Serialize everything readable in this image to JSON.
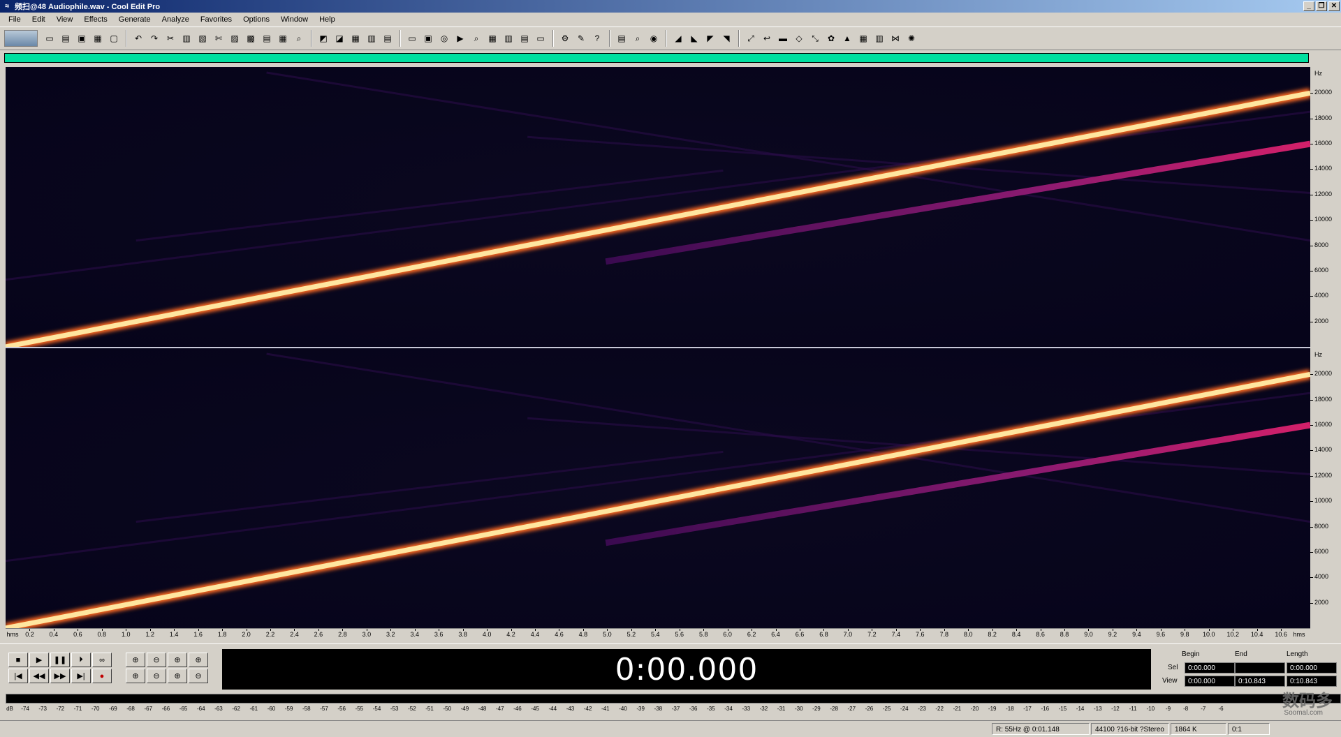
{
  "window": {
    "title": "频扫@48 Audiophile.wav - Cool Edit Pro",
    "app_icon": "cool-edit-icon",
    "controls": [
      "_",
      "❐",
      "✕"
    ]
  },
  "menu": [
    "File",
    "Edit",
    "View",
    "Effects",
    "Generate",
    "Analyze",
    "Favorites",
    "Options",
    "Window",
    "Help"
  ],
  "colors": {
    "overview": "#00e0a0",
    "spectral_background": "#07051a",
    "sweep_main": "#ffe6a0",
    "sweep_harmonic": "#d4206a",
    "channel_separator": "#c8c8d8"
  },
  "spectral": {
    "freq_unit": "Hz",
    "freq_labels": [
      "20000",
      "18000",
      "16000",
      "14000",
      "12000",
      "10000",
      "8000",
      "6000",
      "4000",
      "2000"
    ],
    "time_unit": "hms",
    "time_labels": [
      "0.2",
      "0.4",
      "0.6",
      "0.8",
      "1.0",
      "1.2",
      "1.4",
      "1.6",
      "1.8",
      "2.0",
      "2.2",
      "2.4",
      "2.6",
      "2.8",
      "3.0",
      "3.2",
      "3.4",
      "3.6",
      "3.8",
      "4.0",
      "4.2",
      "4.4",
      "4.6",
      "4.8",
      "5.0",
      "5.2",
      "5.4",
      "5.6",
      "5.8",
      "6.0",
      "6.2",
      "6.4",
      "6.6",
      "6.8",
      "7.0",
      "7.2",
      "7.4",
      "7.6",
      "7.8",
      "8.0",
      "8.2",
      "8.4",
      "8.6",
      "8.8",
      "9.0",
      "9.2",
      "9.4",
      "9.6",
      "9.8",
      "10.0",
      "10.2",
      "10.4",
      "10.6"
    ],
    "channels": [
      {
        "name": "left",
        "sweep_end_hz": 20000,
        "harmonic_end_hz": 16000
      },
      {
        "name": "right",
        "sweep_end_hz": 20000,
        "harmonic_end_hz": 16000
      }
    ],
    "freq_max_hz": 22050,
    "duration_s": 10.843
  },
  "transport": {
    "buttons_row1": [
      "■",
      "▶",
      "❚❚",
      "⏵",
      "∞"
    ],
    "buttons_row2": [
      "|◀",
      "◀◀",
      "▶▶",
      "▶|",
      "●"
    ],
    "zoom_row1": [
      "⊕",
      "⊖",
      "⊕",
      "⊕"
    ],
    "zoom_row2": [
      "⊕",
      "⊖",
      "⊕",
      "⊖"
    ]
  },
  "time_display": "0:00.000",
  "selection": {
    "headers": {
      "begin": "Begin",
      "end": "End",
      "length": "Length"
    },
    "sel_label": "Sel",
    "view_label": "View",
    "sel": {
      "begin": "0:00.000",
      "end": "",
      "length": "0:00.000"
    },
    "view": {
      "begin": "0:00.000",
      "end": "0:10.843",
      "length": "0:10.843"
    }
  },
  "meter": {
    "unit": "dB",
    "labels": [
      "-74",
      "-73",
      "-72",
      "-71",
      "-70",
      "-69",
      "-68",
      "-67",
      "-66",
      "-65",
      "-64",
      "-63",
      "-62",
      "-61",
      "-60",
      "-59",
      "-58",
      "-57",
      "-56",
      "-55",
      "-54",
      "-53",
      "-52",
      "-51",
      "-50",
      "-49",
      "-48",
      "-47",
      "-46",
      "-45",
      "-44",
      "-43",
      "-42",
      "-41",
      "-40",
      "-39",
      "-38",
      "-37",
      "-36",
      "-35",
      "-34",
      "-33",
      "-32",
      "-31",
      "-30",
      "-29",
      "-28",
      "-27",
      "-26",
      "-25",
      "-24",
      "-23",
      "-22",
      "-21",
      "-20",
      "-19",
      "-18",
      "-17",
      "-16",
      "-15",
      "-14",
      "-13",
      "-12",
      "-11",
      "-10",
      "-9",
      "-8",
      "-7",
      "-6"
    ]
  },
  "status": {
    "cursor": "R: 55Hz @   0:01.148",
    "format": "44100 ?16-bit ?Stereo",
    "size": "1864 K",
    "extra": "0:1"
  },
  "watermark": {
    "text": "数码多",
    "sub": "Soomal.com"
  }
}
